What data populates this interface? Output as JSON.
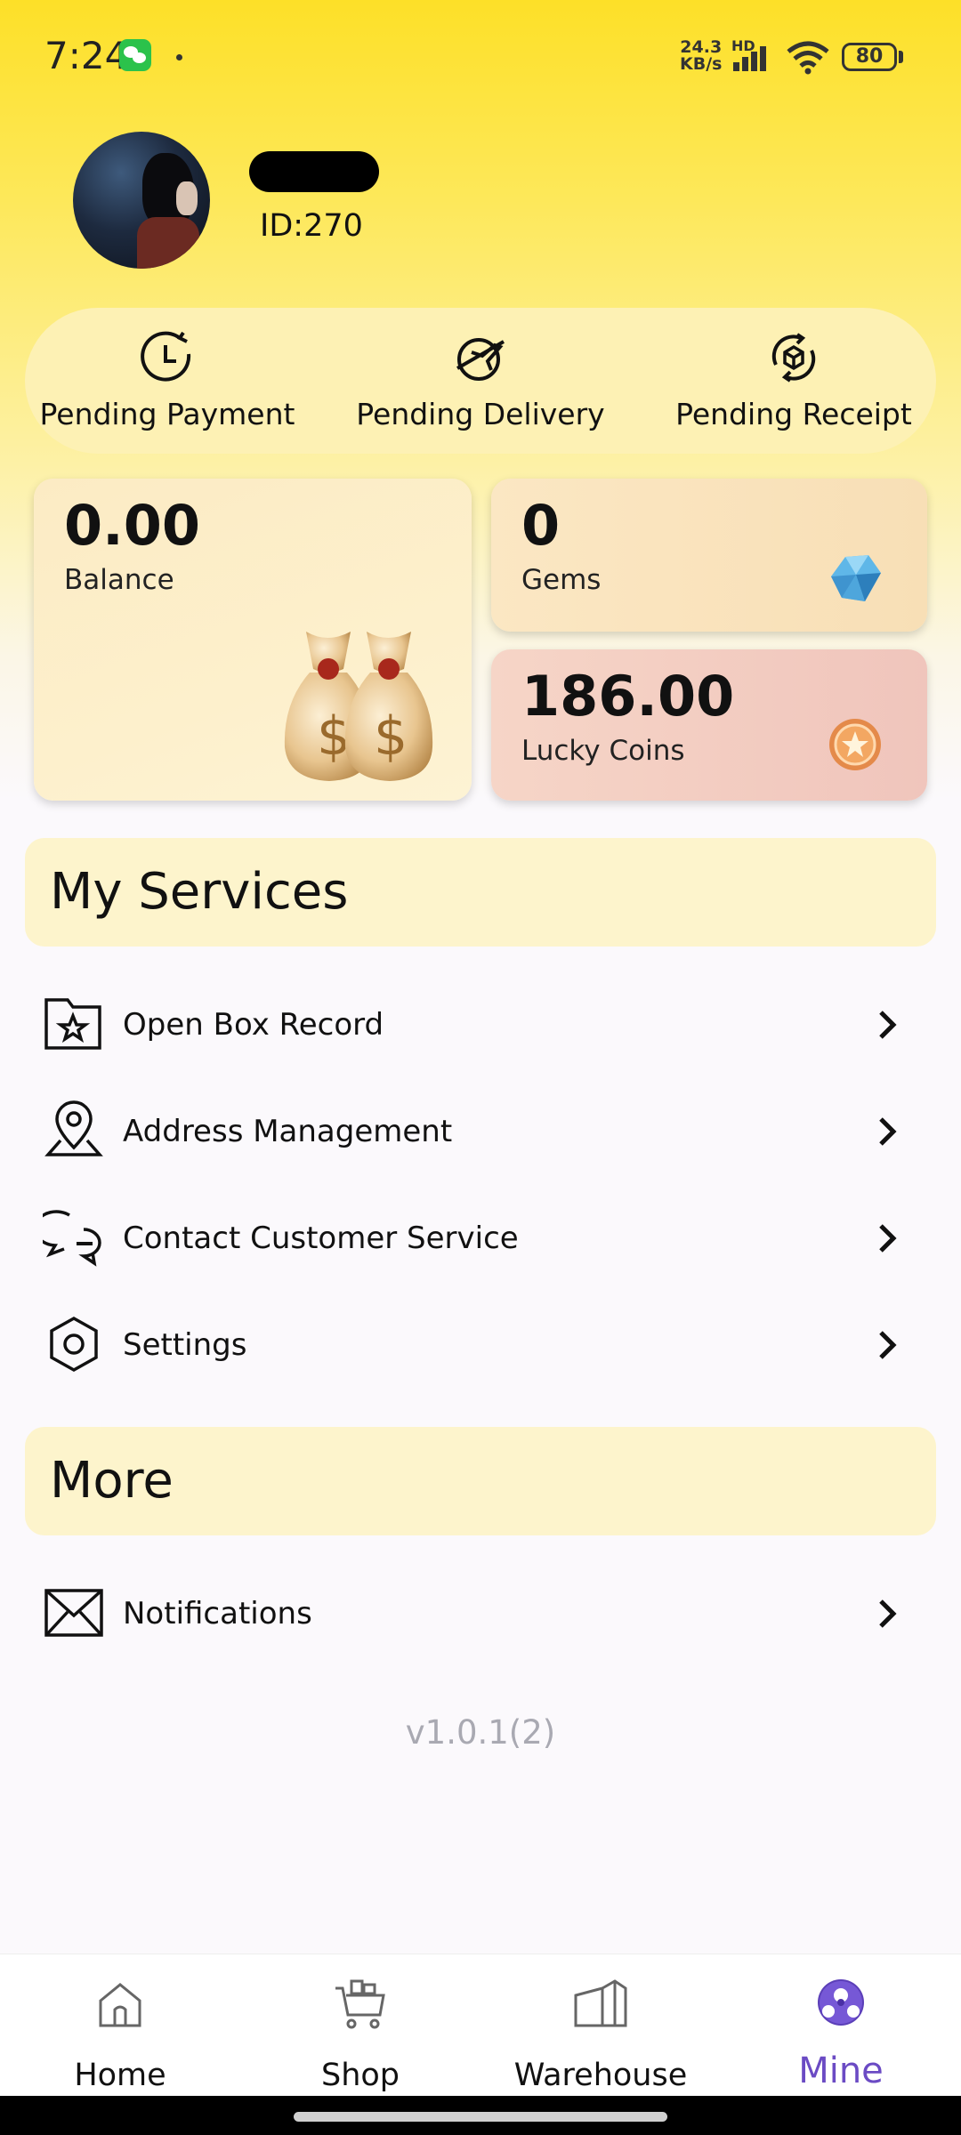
{
  "status_bar": {
    "time": "7:24",
    "net_speed_value": "24.3",
    "net_speed_unit": "KB/s",
    "net_type": "HD",
    "battery": "80"
  },
  "profile": {
    "id_text": "ID:270"
  },
  "orders": [
    {
      "label": "Pending Payment",
      "icon": "clock-icon"
    },
    {
      "label": "Pending Delivery",
      "icon": "plane-icon"
    },
    {
      "label": "Pending Receipt",
      "icon": "box-cycle-icon"
    }
  ],
  "wallet": {
    "balance": {
      "value": "0.00",
      "label": "Balance"
    },
    "gems": {
      "value": "0",
      "label": "Gems"
    },
    "lucky_coins": {
      "value": "186.00",
      "label": "Lucky Coins"
    }
  },
  "services": {
    "title": "My Services",
    "items": [
      {
        "label": "Open Box Record",
        "icon": "folder-star-icon"
      },
      {
        "label": "Address Management",
        "icon": "location-pin-icon"
      },
      {
        "label": "Contact Customer Service",
        "icon": "chat-icon"
      },
      {
        "label": "Settings",
        "icon": "gear-icon"
      }
    ]
  },
  "more": {
    "title": "More",
    "items": [
      {
        "label": "Notifications",
        "icon": "envelope-icon"
      }
    ]
  },
  "version": "v1.0.1(2)",
  "bottom_nav": [
    {
      "label": "Home",
      "icon": "home-icon"
    },
    {
      "label": "Shop",
      "icon": "cart-icon"
    },
    {
      "label": "Warehouse",
      "icon": "warehouse-icon"
    },
    {
      "label": "Mine",
      "icon": "ball-icon",
      "active": true
    }
  ],
  "colors": {
    "header_yellow": "#fde028",
    "section_bg": "#fdf4cc",
    "active_nav": "#6b4bc4",
    "version_text": "#a9a9b2"
  }
}
